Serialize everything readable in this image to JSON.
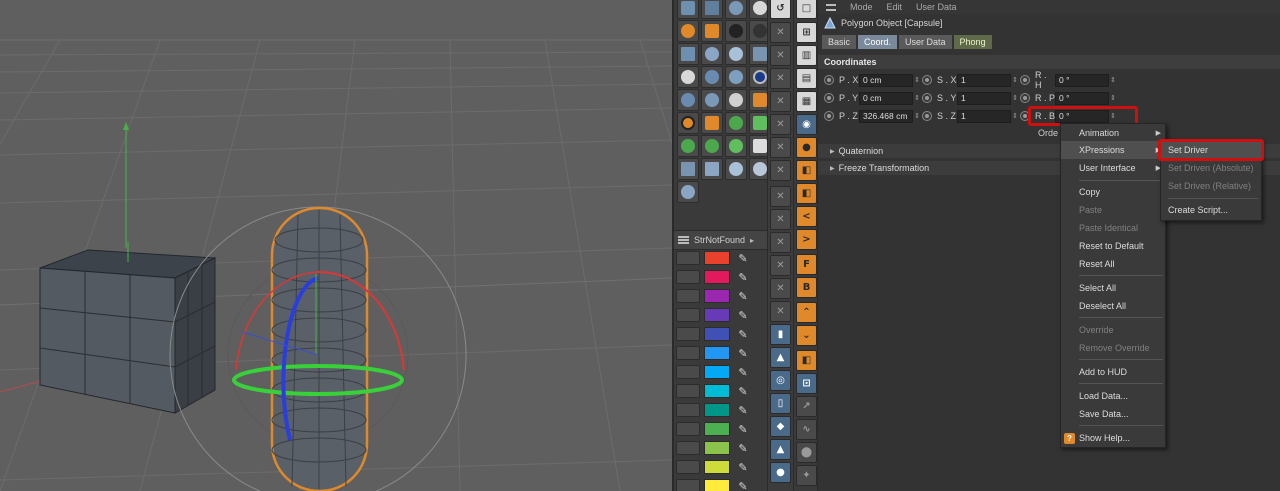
{
  "attribute_manager": {
    "menu": [
      "Mode",
      "Edit",
      "User Data"
    ],
    "title": "Polygon Object [Capsule]",
    "tabs": [
      "Basic",
      "Coord.",
      "User Data",
      "Phong"
    ],
    "active_tab": "Coord.",
    "section": "Coordinates",
    "fields": [
      {
        "label": "P . X",
        "value": "0 cm"
      },
      {
        "label": "P . Y",
        "value": "0 cm"
      },
      {
        "label": "P . Z",
        "value": "326.468 cm"
      },
      {
        "label": "S . X",
        "value": "1"
      },
      {
        "label": "S . Y",
        "value": "1"
      },
      {
        "label": "S . Z",
        "value": "1"
      },
      {
        "label": "R . H",
        "value": "0 °"
      },
      {
        "label": "R . P",
        "value": "0 °"
      },
      {
        "label": "R . B",
        "value": "0 °"
      }
    ],
    "order_label": "Orde",
    "fold_rows": [
      "Quaternion",
      "Freeze Transformation"
    ]
  },
  "context_menu": {
    "items": [
      {
        "label": "Animation",
        "submenu": true,
        "enabled": true
      },
      {
        "label": "XPressions",
        "submenu": true,
        "enabled": true,
        "highlighted": true
      },
      {
        "label": "User Interface",
        "submenu": true,
        "enabled": true
      },
      {
        "label": "Copy",
        "enabled": true
      },
      {
        "label": "Paste",
        "enabled": false
      },
      {
        "label": "Paste Identical",
        "enabled": false
      },
      {
        "label": "Reset to Default",
        "enabled": true
      },
      {
        "label": "Reset All",
        "enabled": true
      },
      {
        "label": "Select All",
        "enabled": true
      },
      {
        "label": "Deselect All",
        "enabled": true
      },
      {
        "label": "Override",
        "enabled": false
      },
      {
        "label": "Remove Override",
        "enabled": false
      },
      {
        "label": "Add to HUD",
        "enabled": true
      },
      {
        "label": "Load Data...",
        "enabled": true
      },
      {
        "label": "Save Data...",
        "enabled": true
      },
      {
        "label": "Show Help...",
        "enabled": true,
        "icon": "?"
      }
    ]
  },
  "submenu": {
    "items": [
      {
        "label": "Set Driver",
        "enabled": true,
        "highlighted": true
      },
      {
        "label": "Set Driven (Absolute)",
        "enabled": false
      },
      {
        "label": "Set Driven (Relative)",
        "enabled": false
      },
      {
        "label": "Create Script...",
        "enabled": true
      }
    ]
  },
  "swatches": {
    "title": "StrNotFound",
    "colors": [
      "#e8412c",
      "#e3195d",
      "#9b27b0",
      "#673ab7",
      "#3f51b5",
      "#2196f3",
      "#03a9f4",
      "#00bcd4",
      "#009688",
      "#4caf50",
      "#8bc34a",
      "#cddc39",
      "#ffeb3b"
    ]
  },
  "colors": {
    "highlight_red": "#d20f0f",
    "accent_orange": "#e0892a",
    "viewport_bg": "#5f5f5f"
  },
  "toolbar_letters": {
    "f": "F",
    "b": "B"
  }
}
